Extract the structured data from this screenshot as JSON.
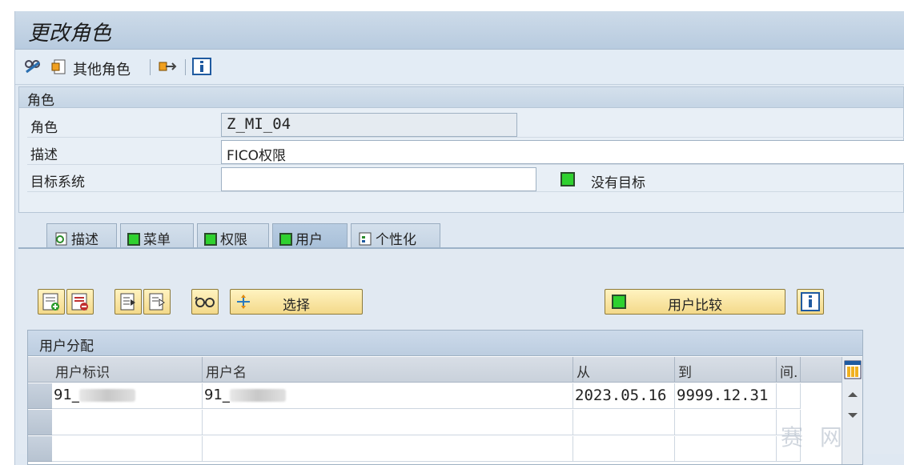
{
  "window": {
    "title": "更改角色"
  },
  "toolbar": {
    "other_role_label": "其他角色"
  },
  "role_group": {
    "header": "角色",
    "role_label": "角色",
    "role_value": "Z_MI_04",
    "desc_label": "描述",
    "desc_value": "FICO权限",
    "target_label": "目标系统",
    "target_value": "",
    "no_target_label": "没有目标"
  },
  "tabs": [
    {
      "label": "描述",
      "icon": "describe-icon"
    },
    {
      "label": "菜单",
      "icon": "green-status-icon"
    },
    {
      "label": "权限",
      "icon": "green-status-icon"
    },
    {
      "label": "用户",
      "icon": "green-status-icon",
      "active": true
    },
    {
      "label": "个性化",
      "icon": "personalize-icon"
    }
  ],
  "users_tab": {
    "select_label": "选择",
    "compare_label": "用户比较"
  },
  "user_table": {
    "title": "用户分配",
    "columns": [
      "用户标识",
      "用户名",
      "从",
      "到",
      "间."
    ],
    "rows": [
      {
        "user_id": "91_",
        "user_name": "91_",
        "from": "2023.05.16",
        "to": "9999.12.31"
      }
    ]
  },
  "watermark": "赛 网",
  "colors": {
    "status_green": "#2fd12f",
    "button_yellow": "#f3d98a",
    "panel_blue": "#dfe8f2"
  }
}
